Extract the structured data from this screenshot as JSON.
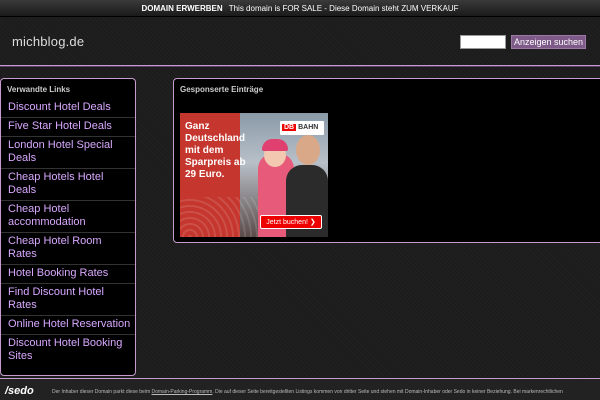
{
  "topbar": {
    "link_label": "DOMAIN ERWERBEN",
    "message": "This domain is FOR SALE - Diese Domain steht ZUM VERKAUF"
  },
  "header": {
    "site_title": "michblog.de",
    "search_value": "",
    "search_button_label": "Anzeigen suchen"
  },
  "sidebar": {
    "heading": "Verwandte Links",
    "items": [
      "Discount Hotel Deals",
      "Five Star Hotel Deals",
      "London Hotel Special Deals",
      "Cheap Hotels Hotel Deals",
      "Cheap Hotel accommodation",
      "Cheap Hotel Room Rates",
      "Hotel Booking Rates",
      "Find Discount Hotel Rates",
      "Online Hotel Reservation",
      "Discount Hotel Booking Sites"
    ]
  },
  "main": {
    "heading": "Gesponserte Einträge",
    "ad": {
      "headline": "Ganz Deutschland mit dem Sparpreis ab 29 Euro.",
      "logo_db": "DB",
      "logo_text": "BAHN",
      "cta": "Jetzt buchen! ❯"
    }
  },
  "footer": {
    "logo": "/sedo",
    "text_before": "Der Inhaber dieser Domain parkt diese beim",
    "link": "Domain-Parking-Programm",
    "text_after": ". Die auf dieser Seite bereitgestellten Listings kommen von dritter Seite und stehen mit Domain-Inhaber oder Sedo in keiner Beziehung. Bei markenrechtlichen"
  },
  "colors": {
    "accent_border": "#c79bd0",
    "link": "#d9a8ff",
    "button": "#7d5a88"
  }
}
